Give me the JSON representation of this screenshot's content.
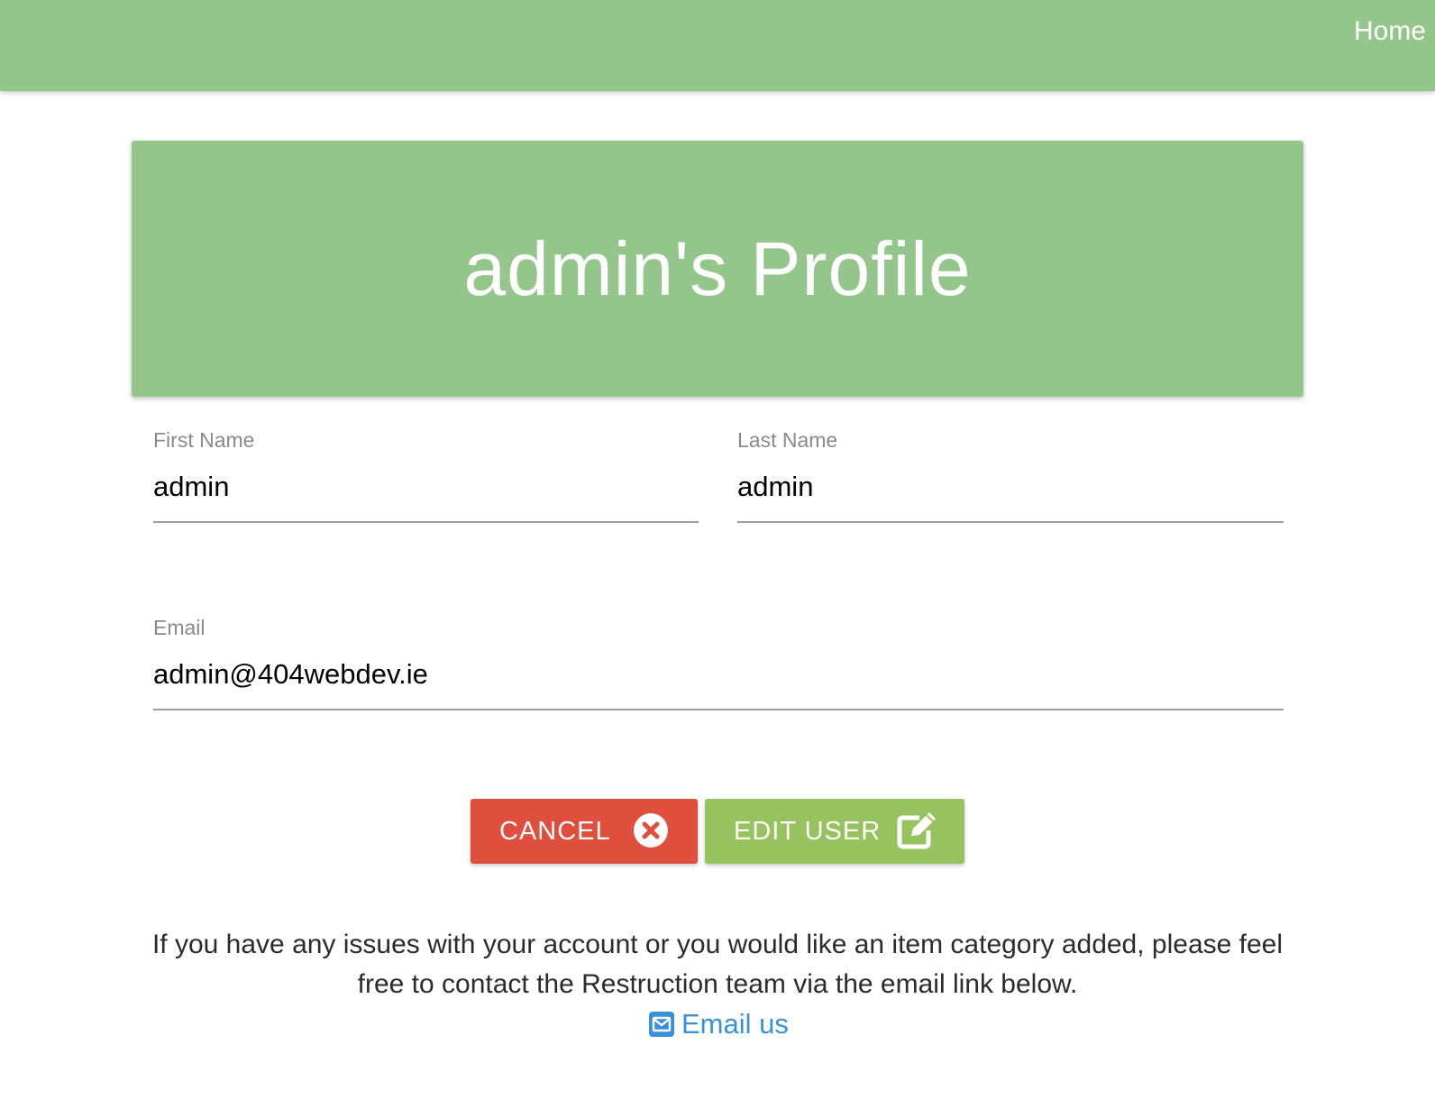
{
  "nav": {
    "home_label": "Home"
  },
  "hero": {
    "title": "admin's Profile"
  },
  "form": {
    "first_name": {
      "label": "First Name",
      "value": "admin"
    },
    "last_name": {
      "label": "Last Name",
      "value": "admin"
    },
    "email": {
      "label": "Email",
      "value": "admin@404webdev.ie"
    }
  },
  "buttons": {
    "cancel_label": "CANCEL",
    "cancel_icon": "close-circle-icon",
    "edit_label": "EDIT USER",
    "edit_icon": "edit-icon"
  },
  "message": "If you have any issues with your account or you would like an item category added, please feel free to contact the Restruction team via the email link below.",
  "email_link": {
    "label": "Email us",
    "icon": "envelope-icon"
  },
  "colors": {
    "header_green": "#94c68b",
    "cancel_red": "#e04e3d",
    "edit_green": "#96c35d",
    "link_blue": "#3b91d8"
  }
}
